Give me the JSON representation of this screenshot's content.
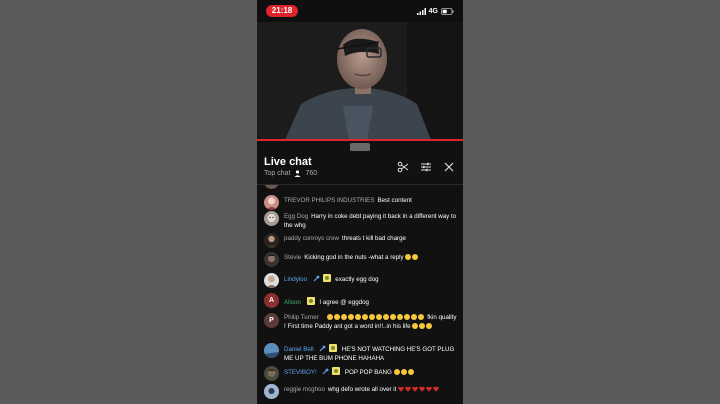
{
  "status_bar": {
    "time": "21:18",
    "network": "4G"
  },
  "colors": {
    "accent": "#e0242c",
    "author_blue": "#5ea3f0",
    "author_green": "#3fb36a",
    "author_gray": "#aaaaaa"
  },
  "chat": {
    "title": "Live chat",
    "mode": "Top chat",
    "viewer_count": "760",
    "icons": [
      "scissors-icon",
      "tune-icon",
      "close-icon"
    ]
  },
  "messages": [
    {
      "author": "TREVOR PHILIPS INDUSTRIES",
      "text": "Best content"
    },
    {
      "author": "Egg Dog",
      "text": "Harry in coke debt paying it back in a different way to the whg"
    },
    {
      "author": "paddy conroys crew",
      "text": "threats t kill bad charge"
    },
    {
      "author": "Stevie",
      "text": "Kicking god in the nuts -what a reply",
      "emoji_count": 2
    },
    {
      "author": "Lindyloo",
      "text": "exactly egg dog",
      "avatar_letter": ""
    },
    {
      "author": "Alison",
      "text": "I agree @ eggdog",
      "avatar_letter": "A"
    },
    {
      "author": "Philip Turner",
      "text": "fkin quality ! First time Paddy ant got a word in!!..in his life",
      "avatar_letter": "P",
      "emoji_count": 14,
      "trailing_emoji_count": 3
    },
    {
      "author": "Daniel Bell",
      "text": "HE'S NOT WATCHING HE'S GOT PLUG ME UP THE BUM PHONE HAHAHA"
    },
    {
      "author": "STEVIBOY!",
      "text": "POP POP BANG",
      "emoji_count": 3
    },
    {
      "author": "reggie mcghoo",
      "text": "whg defo wrote all over it",
      "heart_count": 6
    }
  ]
}
